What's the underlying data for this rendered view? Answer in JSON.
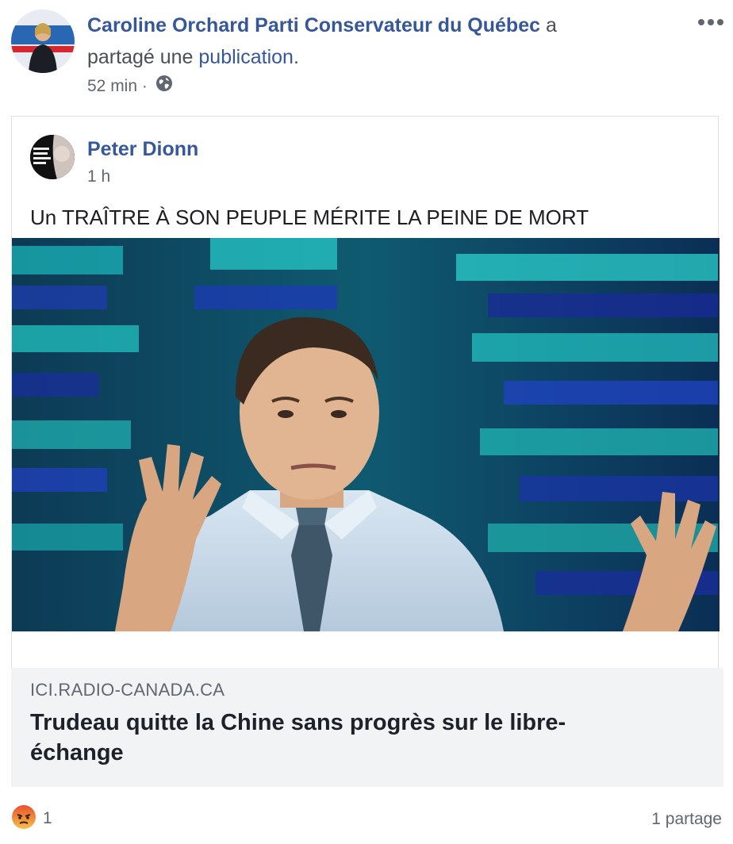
{
  "post": {
    "author": "Caroline Orchard Parti Conservateur du Québec",
    "verb_before": "a",
    "verb_after": "partagé une",
    "link_word": "publication",
    "period": ".",
    "time": "52 min",
    "separator": "·",
    "privacy_icon": "globe-icon",
    "menu_icon": "more-options-icon"
  },
  "shared": {
    "author": "Peter Dionn",
    "time": "1 h",
    "text": "Un TRAÎTRE À SON PEUPLE MÉRITE LA PEINE DE MORT"
  },
  "link_preview": {
    "domain": "ICI.RADIO-CANADA.CA",
    "title": "Trudeau quitte la Chine sans progrès sur le libre-échange"
  },
  "footer": {
    "reaction_icon": "angry-reaction-icon",
    "reaction_count": "1",
    "shares": "1 partage"
  },
  "colors": {
    "link_blue": "#365899",
    "card_gray": "#f2f3f5",
    "meta_gray": "#616770"
  }
}
